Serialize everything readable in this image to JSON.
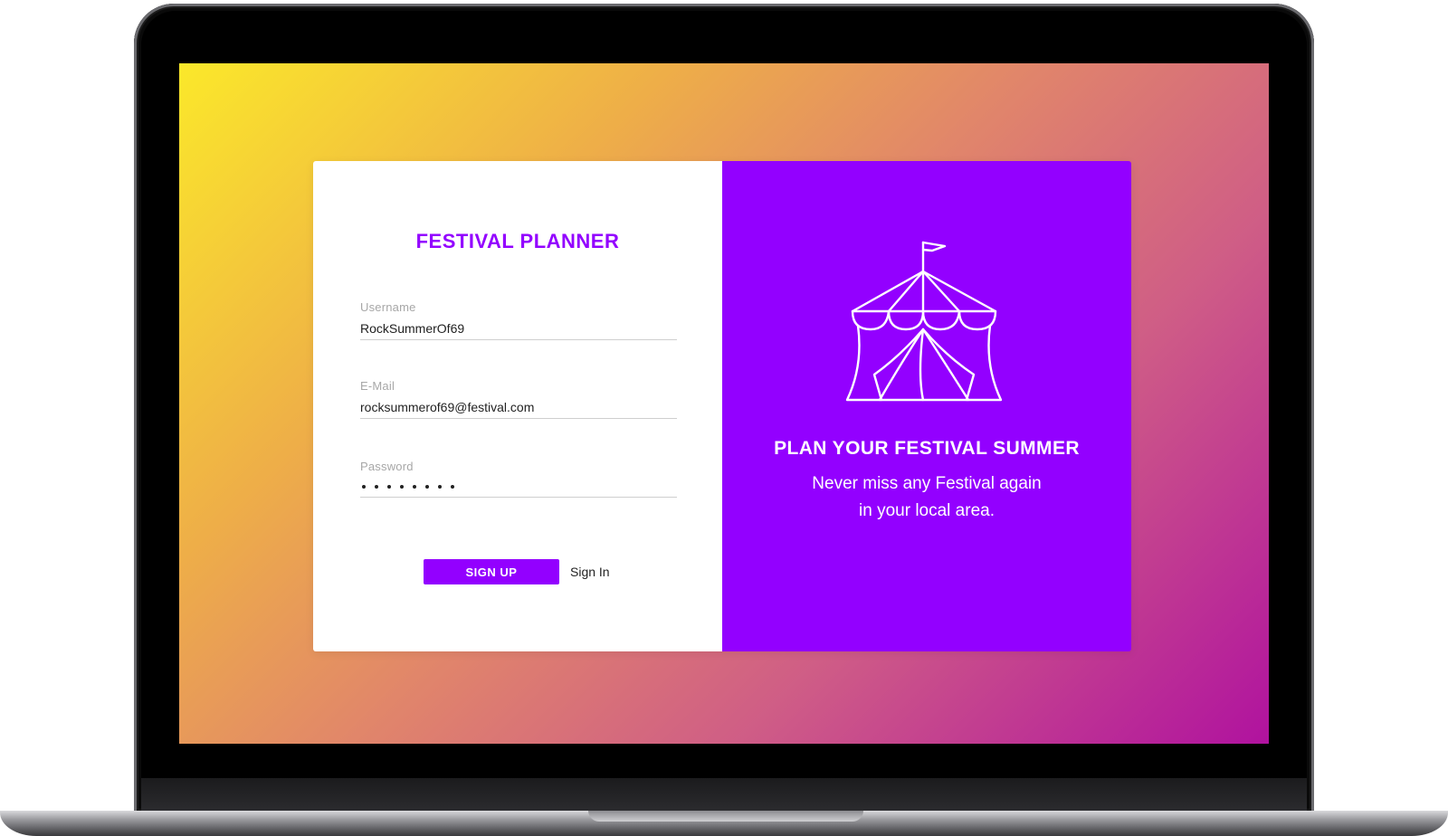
{
  "app": {
    "title": "FESTIVAL PLANNER"
  },
  "form": {
    "username": {
      "label": "Username",
      "value": "RockSummerOf69"
    },
    "email": {
      "label": "E-Mail",
      "value": "rocksummerof69@festival.com"
    },
    "password": {
      "label": "Password",
      "masked_length": 8
    },
    "signup_label": "SIGN UP",
    "signin_label": "Sign In"
  },
  "promo": {
    "icon": "circus-tent-icon",
    "title": "PLAN YOUR FESTIVAL SUMMER",
    "subtitle_line1": "Never miss any Festival again",
    "subtitle_line2": "in your local area."
  },
  "colors": {
    "accent": "#9300ff",
    "gradient_start": "#fbe82a",
    "gradient_end": "#b0129f"
  }
}
